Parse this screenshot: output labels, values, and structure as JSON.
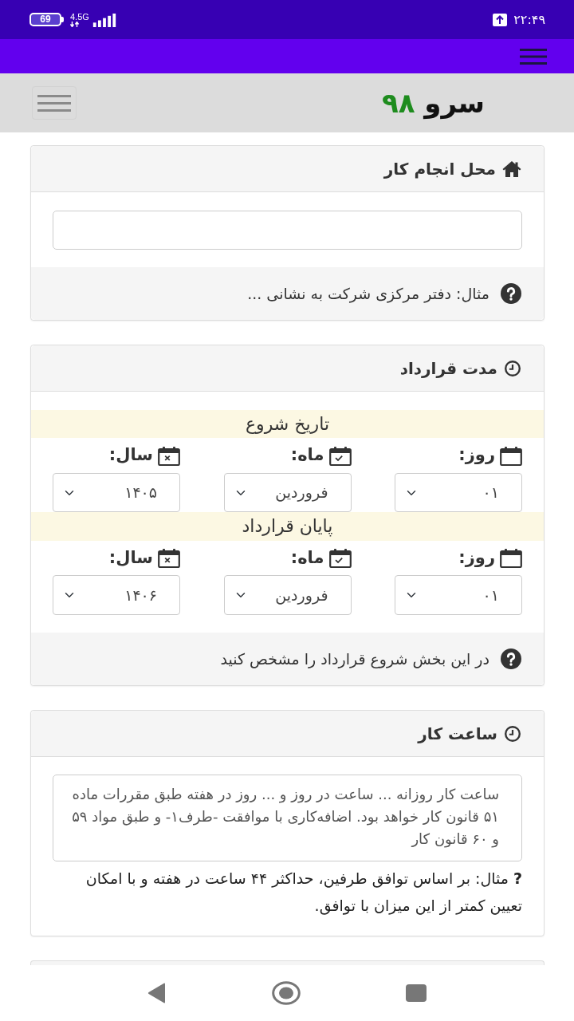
{
  "status_bar": {
    "battery": "69",
    "network": "4.5G",
    "time": "۲۲:۴۹"
  },
  "header": {
    "logo": {
      "name": "سرو",
      "number": "۹۸"
    }
  },
  "work_place": {
    "title": "محل انجام کار",
    "hint": "مثال: دفتر مرکزی شرکت به نشانی ..."
  },
  "contract_duration": {
    "title": "مدت قرارداد",
    "start": {
      "title": "تاریخ شروع",
      "day": {
        "label": "روز:",
        "value": "۰۱"
      },
      "month": {
        "label": "ماه:",
        "value": "فروردین"
      },
      "year": {
        "label": "سال:",
        "value": "۱۴۰۵"
      }
    },
    "end": {
      "title": "پایان قرارداد",
      "day": {
        "label": "روز:",
        "value": "۰۱"
      },
      "month": {
        "label": "ماه:",
        "value": "فروردین"
      },
      "year": {
        "label": "سال:",
        "value": "۱۴۰۶"
      }
    },
    "hint": "در این بخش شروع قرارداد را مشخص کنید"
  },
  "work_hours": {
    "title": "ساعت کار",
    "textarea": {
      "value": "ساعت کار روزانه ... ساعت در روز و ... روز در هفته طبق مقررات ماده ۵۱ قانون کار خواهد بود. اضافه‌کاری با موافقت -طرف۱- و طبق مواد ۵۹ و ۶۰ قانون کار"
    },
    "hint": "**?** مثال: بر اساس توافق طرفین، حداکثر ۴۴ ساعت در هفته و با امکان تعیین کمتر از این میزان با توافق."
  }
}
